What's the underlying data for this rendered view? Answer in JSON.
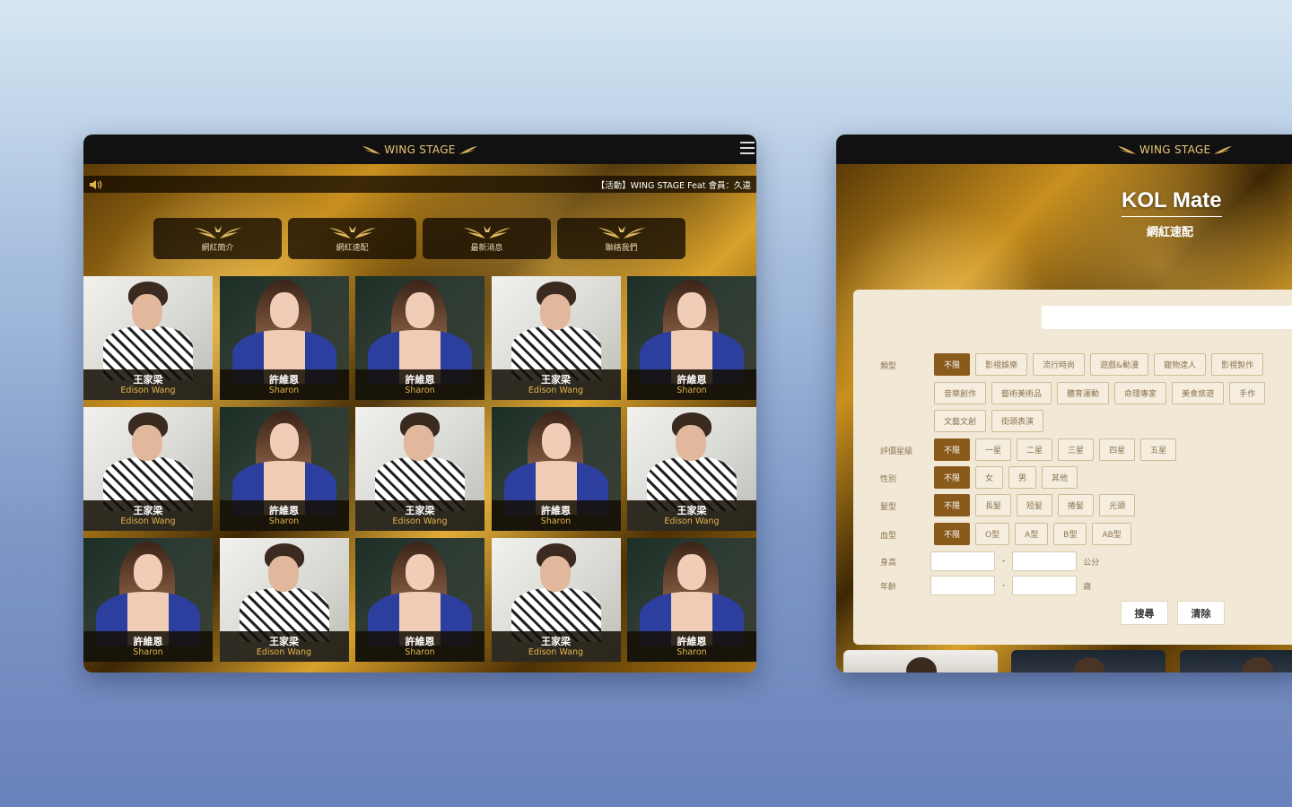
{
  "left": {
    "logo": "WING STAGE",
    "marquee": "【活動】WING STAGE Feat 會員：久違",
    "nav": [
      "網紅簡介",
      "網紅速配",
      "最新消息",
      "聯絡我們"
    ],
    "cards": [
      {
        "zh": "王家梁",
        "en": "Edison Wang",
        "g": "m"
      },
      {
        "zh": "許維恩",
        "en": "Sharon",
        "g": "f"
      },
      {
        "zh": "許維恩",
        "en": "Sharon",
        "g": "f"
      },
      {
        "zh": "王家梁",
        "en": "Edison Wang",
        "g": "m"
      },
      {
        "zh": "許維恩",
        "en": "Sharon",
        "g": "f"
      },
      {
        "zh": "王家梁",
        "en": "Edison Wang",
        "g": "m"
      },
      {
        "zh": "許維恩",
        "en": "Sharon",
        "g": "f"
      },
      {
        "zh": "王家梁",
        "en": "Edison Wang",
        "g": "m"
      },
      {
        "zh": "許維恩",
        "en": "Sharon",
        "g": "f"
      },
      {
        "zh": "王家梁",
        "en": "Edison Wang",
        "g": "m"
      },
      {
        "zh": "許維恩",
        "en": "Sharon",
        "g": "f"
      },
      {
        "zh": "王家梁",
        "en": "Edison Wang",
        "g": "m"
      },
      {
        "zh": "許維恩",
        "en": "Sharon",
        "g": "f"
      },
      {
        "zh": "王家梁",
        "en": "Edison Wang",
        "g": "m"
      },
      {
        "zh": "許維恩",
        "en": "Sharon",
        "g": "f"
      }
    ]
  },
  "right": {
    "logo": "WING STAGE",
    "title": "KOL Mate",
    "subtitle": "網紅速配",
    "filters": [
      {
        "label": "類型",
        "rows": [
          [
            "不限",
            "影視娛樂",
            "流行時尚",
            "遊戲&動漫",
            "寵物達人",
            "影視製作"
          ],
          [
            "音樂創作",
            "藝術美術品",
            "體育運動",
            "命理專家",
            "美食旅遊",
            "手作"
          ],
          [
            "文藝文創",
            "街頭表演"
          ]
        ]
      },
      {
        "label": "評價星級",
        "rows": [
          [
            "不限",
            "一星",
            "二星",
            "三星",
            "四星",
            "五星"
          ]
        ]
      },
      {
        "label": "性別",
        "rows": [
          [
            "不限",
            "女",
            "男",
            "其他"
          ]
        ]
      },
      {
        "label": "髮型",
        "rows": [
          [
            "不限",
            "長髮",
            "短髮",
            "捲髮",
            "光頭"
          ]
        ]
      },
      {
        "label": "血型",
        "rows": [
          [
            "不限",
            "O型",
            "A型",
            "B型",
            "AB型"
          ]
        ]
      }
    ],
    "height_label": "身高",
    "height_unit": "公分",
    "age_label": "年齡",
    "age_unit": "歲",
    "range_sep": "-",
    "search_btn": "搜尋",
    "clear_btn": "清除"
  },
  "colors": {
    "gold": "#e2b54a",
    "brown_selected": "#8a5a1c",
    "panel": "#f1e9d6"
  }
}
